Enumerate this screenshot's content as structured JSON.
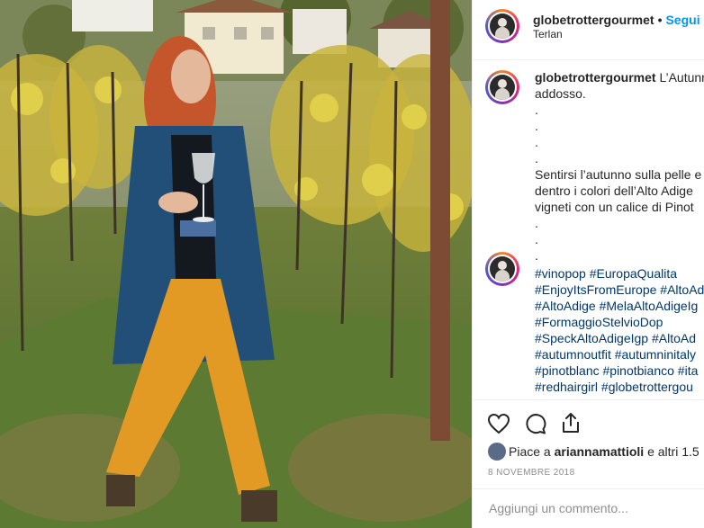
{
  "header": {
    "username": "globetrottergourmet",
    "separator": "•",
    "follow_label": "Segui",
    "location": "Terlan"
  },
  "caption": {
    "username": "globetrottergourmet",
    "lines": [
      "L’Autunno",
      "addosso.",
      ".",
      ".",
      ".",
      ".",
      "Sentirsi l’autunno sulla pelle e",
      "dentro i colori dell’Alto Adige",
      "vigneti con un calice di Pinot",
      ".",
      ".",
      "."
    ]
  },
  "comment": {
    "hashtags": [
      "#vinopop #EuropaQualita",
      "#EnjoyItsFromEurope #AltoAd",
      "#AltoAdige #MelaAltoAdigeIg",
      "#FormaggioStelvioDop",
      "#SpeckAltoAdigeIgp #AltoAd",
      "#autumnoutfit #autumninitaly",
      "#pinotblanc #pinotbianco #ita",
      "#redhairgirl #globetrottergou"
    ]
  },
  "actions": {
    "likes_prefix": "Piace a ",
    "likes_user": "ariannamattioli",
    "likes_suffix": " e altri 1.5",
    "date": "8 NOVEMBRE 2018",
    "comment_placeholder": "Aggiungi un commento..."
  },
  "icons": [
    "heart-icon",
    "comment-icon",
    "share-icon"
  ],
  "colors": {
    "link_blue": "#0095f6",
    "hashtag_blue": "#00376b",
    "text": "#262626",
    "muted": "#8e8e8e"
  }
}
